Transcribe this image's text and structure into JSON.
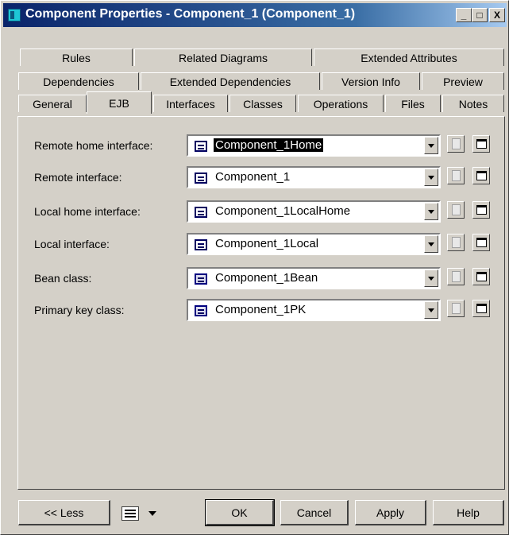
{
  "window": {
    "title": "Component Properties - Component_1 (Component_1)",
    "controls": {
      "minimize": "_",
      "maximize": "□",
      "close": "X"
    }
  },
  "tabs": {
    "row1": [
      "Rules",
      "Related Diagrams",
      "Extended Attributes"
    ],
    "row2": [
      "Dependencies",
      "Extended Dependencies",
      "Version Info",
      "Preview"
    ],
    "row3": [
      "General",
      "EJB",
      "Interfaces",
      "Classes",
      "Operations",
      "Files",
      "Notes"
    ],
    "active": "EJB"
  },
  "fields": [
    {
      "label": "Remote home interface:",
      "value": "Component_1Home",
      "icon": "interface-icon"
    },
    {
      "label": "Remote interface:",
      "value": "Component_1",
      "icon": "interface-icon"
    },
    {
      "label": "Local home interface:",
      "value": "Component_1LocalHome",
      "icon": "interface-icon"
    },
    {
      "label": "Local interface:",
      "value": "Component_1Local",
      "icon": "interface-icon"
    },
    {
      "label": "Bean class:",
      "value": "Component_1Bean",
      "icon": "class-icon"
    },
    {
      "label": "Primary key class:",
      "value": "Component_1PK",
      "icon": "class-icon"
    }
  ],
  "footer": {
    "less": "<< Less",
    "ok": "OK",
    "cancel": "Cancel",
    "apply": "Apply",
    "help": "Help"
  }
}
